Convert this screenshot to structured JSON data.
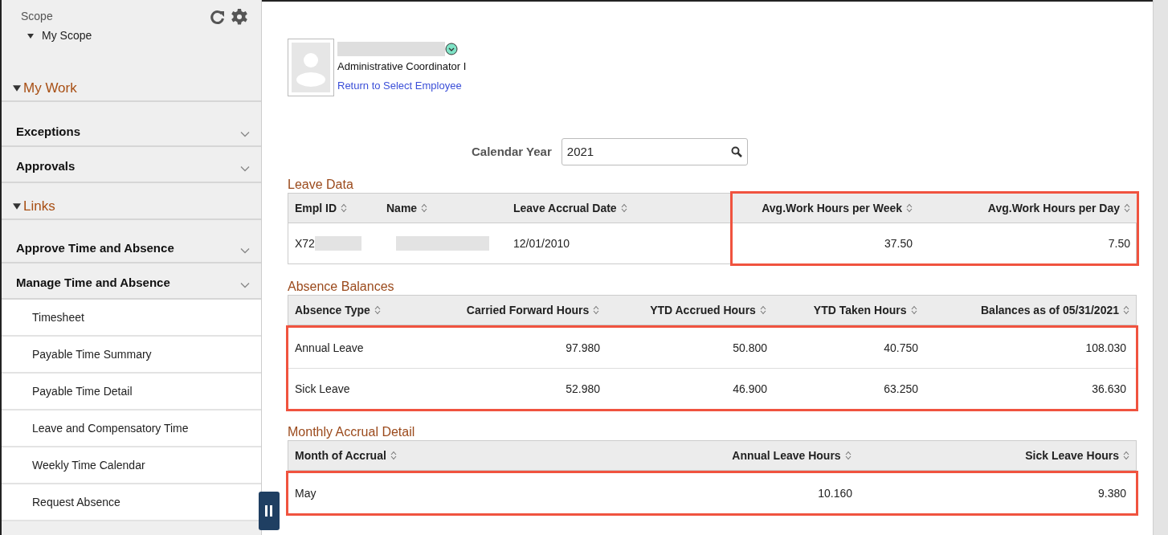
{
  "sidebar": {
    "scope_title": "Scope",
    "scope_item": {
      "label": "My Scope",
      "expanded": true
    },
    "sections": [
      {
        "title": "My Work",
        "expanded": true,
        "items": [
          {
            "label": "Exceptions",
            "expanded": false
          },
          {
            "label": "Approvals",
            "expanded": false
          }
        ]
      },
      {
        "title": "Links",
        "expanded": true,
        "items": [
          {
            "label": "Approve Time and Absence",
            "expanded": false
          },
          {
            "label": "Manage Time and Absence",
            "expanded": true,
            "children": [
              "Timesheet",
              "Payable Time Summary",
              "Payable Time Detail",
              "Leave and Compensatory Time",
              "Weekly Time Calendar",
              "Request Absence"
            ]
          }
        ]
      }
    ]
  },
  "employee": {
    "title": "Administrative Coordinator I",
    "link": "Return to Select Employee"
  },
  "calendar_year": {
    "label": "Calendar Year",
    "value": "2021"
  },
  "leave_data": {
    "title": "Leave Data",
    "columns": [
      {
        "label": "Empl ID",
        "highlighted": false
      },
      {
        "label": "Name",
        "highlighted": false
      },
      {
        "label": "Leave Accrual Date",
        "highlighted": false
      },
      {
        "label": "Avg.Work Hours per Week",
        "highlighted": true
      },
      {
        "label": "Avg.Work Hours per Day",
        "highlighted": true
      }
    ],
    "rows": [
      [
        "X72",
        "",
        "12/01/2010",
        "37.50",
        "7.50"
      ]
    ]
  },
  "absence_balances": {
    "title": "Absence Balances",
    "rows_highlighted": true,
    "columns": [
      "Absence Type",
      "Carried Forward Hours",
      "YTD Accrued Hours",
      "YTD Taken Hours",
      "Balances as of 05/31/2021"
    ],
    "rows": [
      [
        "Annual Leave",
        "97.980",
        "50.800",
        "40.750",
        "108.030"
      ],
      [
        "Sick Leave",
        "52.980",
        "46.900",
        "63.250",
        "36.630"
      ]
    ]
  },
  "monthly_accrual": {
    "title": "Monthly Accrual Detail",
    "rows_highlighted": true,
    "columns": [
      "Month of Accrual",
      "Annual Leave Hours",
      "Sick Leave Hours"
    ],
    "rows": [
      [
        "May",
        "10.160",
        "9.380"
      ]
    ]
  }
}
